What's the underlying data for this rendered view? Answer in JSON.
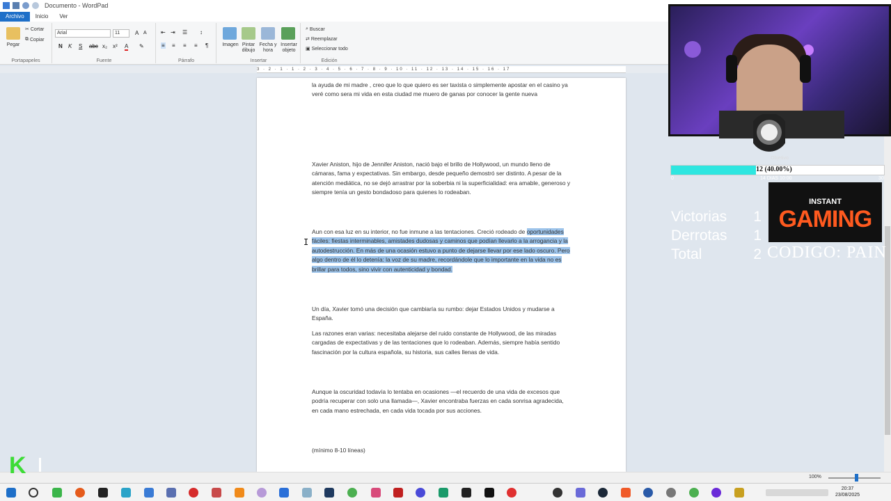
{
  "window": {
    "title": "Documento - WordPad"
  },
  "ribbon": {
    "tabs": [
      "Archivo",
      "Inicio",
      "Ver"
    ],
    "clipboard": {
      "paste": "Pegar",
      "cut": "Cortar",
      "copy": "Copiar",
      "group": "Portapapeles"
    },
    "font": {
      "family": "Arial",
      "size": "11",
      "group": "Fuente"
    },
    "paragraph": {
      "group": "Párrafo"
    },
    "insert": {
      "image": "Imagen",
      "paint": "Pintar dibujo",
      "datetime": "Fecha y hora",
      "object": "Insertar objeto",
      "group": "Insertar"
    },
    "edit": {
      "find": "Buscar",
      "replace": "Reemplazar",
      "select_all": "Seleccionar todo",
      "group": "Edición"
    }
  },
  "ruler": {
    "marks": "3 · 2 · 1 · 1 · 2 · 3 · 4 · 5 · 6 · 7 · 8 · 9 · 10 · 11 · 12 · 13 · 14 · 15 · 16 · 17"
  },
  "document": {
    "p0": "la ayuda de mi madre , creo que lo que quiero es ser taxista o simplemente apostar en el casino ya veré como sera mi vida en esta ciudad me muero de ganas por conocer la gente nueva",
    "p1": "Xavier Aniston, hijo de Jennifer Aniston, nació bajo el brillo de Hollywood, un mundo lleno de cámaras, fama y expectativas. Sin embargo, desde pequeño demostró ser distinto. A pesar de la atención mediática, no se dejó arrastrar por la soberbia ni la superficialidad: era amable, generoso y siempre tenía un gesto bondadoso para quienes lo rodeaban.",
    "p2_start": "Aun con esa luz en su interior, no fue inmune a las tentaciones. Creció rodeado de ",
    "p2_selected": "oportunidades fáciles: fiestas interminables, amistades dudosas y caminos que podían llevarlo a la arrogancia y la autodestrucción. En más de una ocasión estuvo a punto de dejarse llevar por ese lado oscuro. Pero algo dentro de él lo detenía: la voz de su madre, recordándole que lo importante en la vida no es brillar para todos, sino vivir con autenticidad y bondad.",
    "p3": "Un día, Xavier tomó una decisión que cambiaría su rumbo: dejar Estados Unidos y mudarse a España.",
    "p4": "Las razones eran varias: necesitaba alejarse del ruido constante de Hollywood, de las miradas cargadas de expectativas y de las tentaciones que lo rodeaban. Además, siempre había sentido fascinación por la cultura española, su historia, sus calles llenas de vida.",
    "p5": "Aunque la oscuridad todavía lo tentaba en ocasiones —el recuerdo de una vida de excesos que podría recuperar con solo una llamada—, Xavier encontraba fuerzas en cada sonrisa agradecida, en cada mano estrechada, en cada vida tocada por sus acciones.",
    "p6": "(mínimo 8-10 líneas)"
  },
  "statusbar": {
    "zoom": "100%",
    "zoom_fraction": 0.5
  },
  "taskbar": {
    "time": "20:37",
    "date": "23/08/2025"
  },
  "overlay": {
    "goal_label": "Objetivo",
    "goal_text": "12 (40.00%)",
    "goal_fraction": 0.4,
    "goal_min": "0",
    "goal_time": "14 DIAS 10:00",
    "goal_max": "30",
    "stats": [
      {
        "label": "Victorias",
        "value": "1"
      },
      {
        "label": "Derrotas",
        "value": "1"
      },
      {
        "label": "Total",
        "value": "2"
      }
    ],
    "sponsor_top": "INSTANT",
    "sponsor_main": "GAMING",
    "code": "CODIGO: PAIN",
    "k_logo": "K"
  },
  "colors": {
    "accent": "#1e6fc8",
    "selection": "#9cc3ea",
    "goal": "#2ee6e0",
    "sponsor": "#ff5a1f",
    "k_logo": "#3ddc36"
  }
}
